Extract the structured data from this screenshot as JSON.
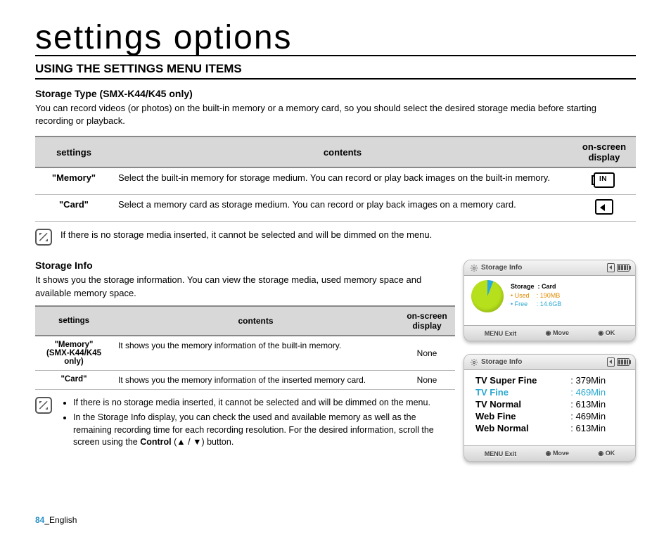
{
  "page_title": "settings options",
  "section_heading": "USING THE SETTINGS MENU ITEMS",
  "storage_type": {
    "heading": "Storage Type (SMX-K44/K45 only)",
    "intro": "You can record videos (or photos) on the built-in memory or a memory card, so you should select the desired storage media before starting recording or playback.",
    "table_headers": {
      "settings": "settings",
      "contents": "contents",
      "osd": "on-screen display"
    },
    "rows": [
      {
        "setting": "\"Memory\"",
        "content": "Select the built-in memory for storage medium. You can record or play back images on the built-in memory."
      },
      {
        "setting": "\"Card\"",
        "content": "Select a memory card as storage medium. You can record or play back images on a memory card."
      }
    ],
    "note": "If there is no storage media inserted, it cannot be selected and will be dimmed on the menu."
  },
  "storage_info": {
    "heading": "Storage Info",
    "intro": "It shows you the storage information. You can view the storage media, used memory space and available memory space.",
    "table_headers": {
      "settings": "settings",
      "contents": "contents",
      "osd": "on-screen display"
    },
    "rows": [
      {
        "setting_line1": "\"Memory\"",
        "setting_line2": "(SMX-K44/K45 only)",
        "content": "It shows you the memory information of the built-in memory.",
        "osd": "None"
      },
      {
        "setting_line1": "\"Card\"",
        "setting_line2": "",
        "content": "It shows you the memory information of the inserted memory card.",
        "osd": "None"
      }
    ],
    "bullets": [
      "If there is no storage media inserted, it cannot be selected and will be dimmed on the menu.",
      "In the Storage Info display, you can check the used and available memory as well as the remaining recording time for each recording resolution. For the desired information, scroll the screen using the Control (▲ / ▼) button."
    ],
    "bullet2_strong": "Control"
  },
  "device1": {
    "title": "Storage Info",
    "storage_label": "Storage",
    "storage_value": ": Card",
    "used_label": "• Used",
    "used_value": ": 190MB",
    "free_label": "• Free",
    "free_value": ": 14.6GB",
    "menu": "MENU",
    "exit": "Exit",
    "move": "Move",
    "ok": "OK"
  },
  "device2": {
    "title": "Storage Info",
    "rows": [
      {
        "name": "TV Super Fine",
        "value": ": 379Min"
      },
      {
        "name": "TV Fine",
        "value": ": 469Min"
      },
      {
        "name": "TV Normal",
        "value": ": 613Min"
      },
      {
        "name": "Web Fine",
        "value": ": 469Min"
      },
      {
        "name": "Web Normal",
        "value": ": 613Min"
      }
    ],
    "highlight_index": 1,
    "menu": "MENU",
    "exit": "Exit",
    "move": "Move",
    "ok": "OK"
  },
  "footer": {
    "page": "84",
    "lang": "_English"
  }
}
